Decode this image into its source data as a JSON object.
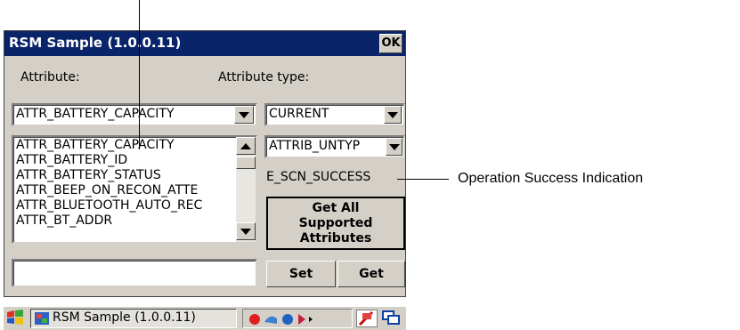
{
  "window": {
    "title": "RSM Sample (1.0.0.11)",
    "ok_label": "OK"
  },
  "labels": {
    "attribute": "Attribute:",
    "attribute_type": "Attribute type:"
  },
  "attribute_select": {
    "value": "ATTR_BATTERY_CAPACITY"
  },
  "type_select": {
    "value": "CURRENT"
  },
  "attribute_list": {
    "items": [
      "ATTR_BATTERY_CAPACITY",
      "ATTR_BATTERY_ID",
      "ATTR_BATTERY_STATUS",
      "ATTR_BEEP_ON_RECON_ATTE",
      "ATTR_BLUETOOTH_AUTO_REC",
      "ATTR_BT_ADDR"
    ]
  },
  "datatype_select": {
    "value": "ATTRIB_UNTYP"
  },
  "status": {
    "text": "E_SCN_SUCCESS"
  },
  "buttons": {
    "get_all": "Get All Supported Attributes",
    "set": "Set",
    "get": "Get"
  },
  "value_input": {
    "value": ""
  },
  "taskbar": {
    "task_label": "RSM Sample (1.0.0.11)"
  },
  "annotation": {
    "text": "Operation Success Indication"
  },
  "colors": {
    "titlebar": "#0a246a",
    "window_bg": "#d4d0c8"
  }
}
